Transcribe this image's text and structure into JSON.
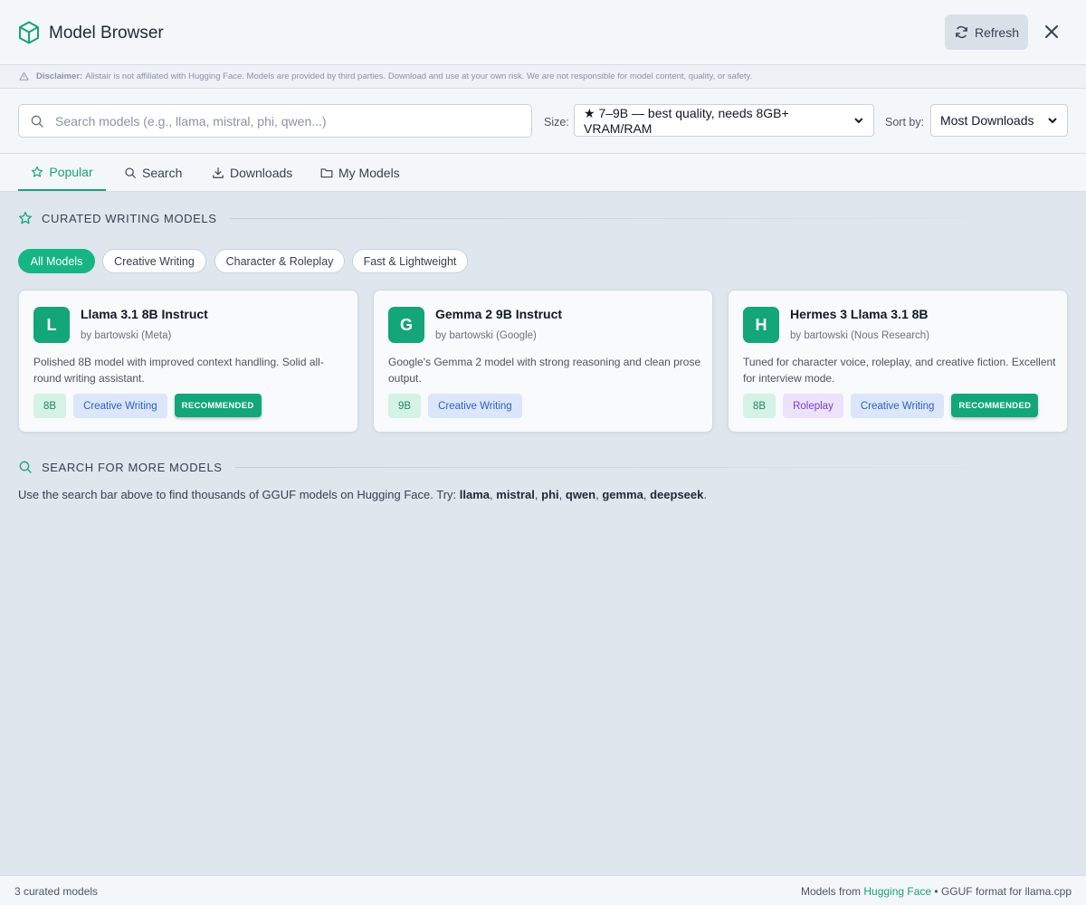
{
  "header": {
    "title": "Model Browser",
    "refresh_label": "Refresh"
  },
  "disclaimer": {
    "label": "Disclaimer:",
    "text": "Alistair is not affiliated with Hugging Face. Models are provided by third parties. Download and use at your own risk. We are not responsible for model content, quality, or safety."
  },
  "search": {
    "placeholder": "Search models (e.g., llama, mistral, phi, qwen...)",
    "size_label": "Size:",
    "size_value": "★ 7–9B — best quality, needs 8GB+ VRAM/RAM",
    "sort_label": "Sort by:",
    "sort_value": "Most Downloads"
  },
  "tabs": [
    {
      "label": "Popular",
      "icon": "star-icon",
      "active": true
    },
    {
      "label": "Search",
      "icon": "search-icon"
    },
    {
      "label": "Downloads",
      "icon": "download-icon"
    },
    {
      "label": "My Models",
      "icon": "folder-icon"
    }
  ],
  "curated": {
    "heading": "CURATED WRITING MODELS",
    "filters": [
      "All Models",
      "Creative Writing",
      "Character & Roleplay",
      "Fast & Lightweight"
    ],
    "models": [
      {
        "initial": "L",
        "name": "Llama 3.1 8B Instruct",
        "by": "by bartowski (Meta)",
        "desc": "Polished 8B model with improved context handling. Solid all-round writing assistant.",
        "tags": [
          "8B",
          "Creative Writing",
          "RECOMMENDED"
        ]
      },
      {
        "initial": "G",
        "name": "Gemma 2 9B Instruct",
        "by": "by bartowski (Google)",
        "desc": "Google's Gemma 2 model with strong reasoning and clean prose output.",
        "tags": [
          "9B",
          "Creative Writing"
        ]
      },
      {
        "initial": "H",
        "name": "Hermes 3 Llama 3.1 8B",
        "by": "by bartowski (Nous Research)",
        "desc": "Tuned for character voice, roleplay, and creative fiction. Excellent for interview mode.",
        "tags": [
          "8B",
          "Roleplay",
          "Creative Writing",
          "RECOMMENDED"
        ]
      }
    ]
  },
  "more": {
    "heading": "SEARCH FOR MORE MODELS",
    "text_before": "Use the search bar above to find thousands of GGUF models on Hugging Face. Try:",
    "examples": [
      "llama",
      "mistral",
      "phi",
      "qwen",
      "gemma",
      "deepseek"
    ],
    "sep": ", ",
    "end": "."
  },
  "footer": {
    "count": "3 curated models",
    "source_prefix": "Models from",
    "source_link": "Hugging Face",
    "source_suffix": "• GGUF format for llama.cpp"
  },
  "colors": {
    "accent": "#16b684",
    "accent_text": "#16a37a",
    "background": "#dfe6ed"
  }
}
